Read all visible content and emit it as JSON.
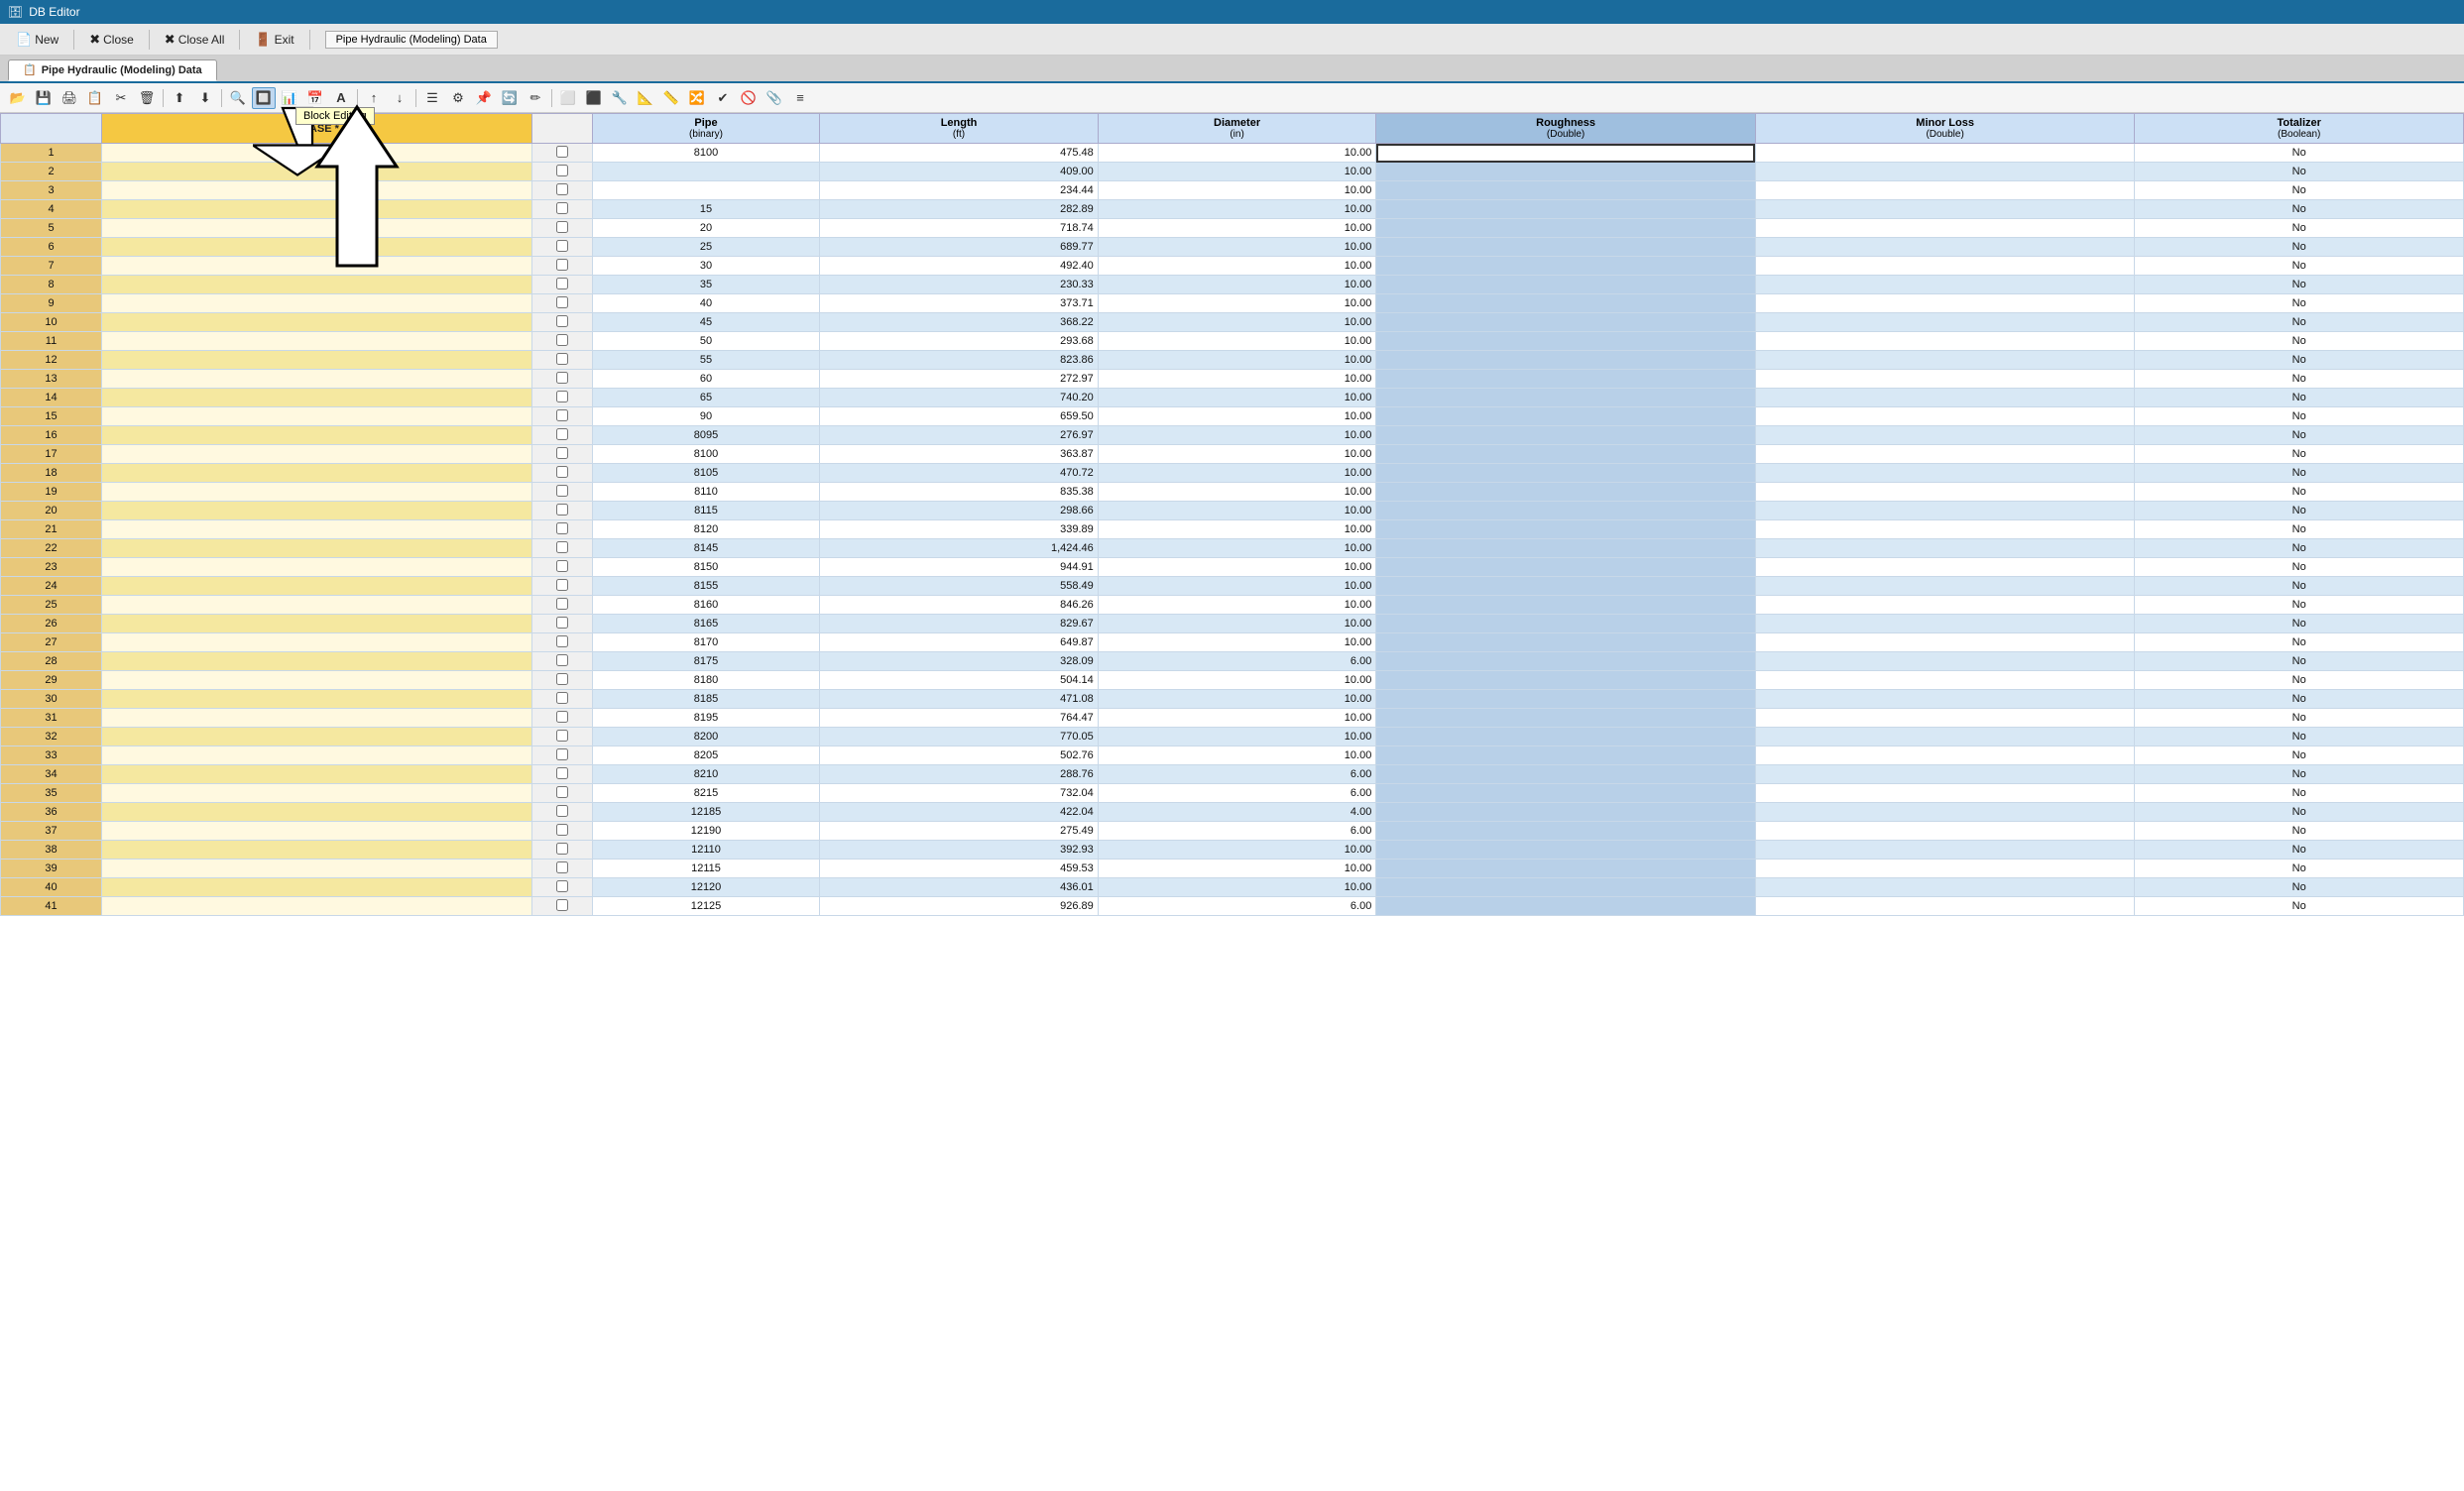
{
  "titleBar": {
    "appName": "DB Editor",
    "icon": "🗄"
  },
  "menuBar": {
    "buttons": [
      {
        "id": "new",
        "icon": "📄",
        "label": "New"
      },
      {
        "id": "close",
        "icon": "✖",
        "label": "Close"
      },
      {
        "id": "closeAll",
        "icon": "✖✖",
        "label": "Close All"
      },
      {
        "id": "exit",
        "icon": "🚪",
        "label": "Exit"
      }
    ],
    "windowTitle": "Pipe Hydraulic (Modeling) Data"
  },
  "tab": {
    "icon": "📋",
    "label": "Pipe Hydraulic (Modeling) Data"
  },
  "iconBar": {
    "icons": [
      "📂",
      "💾",
      "🖨",
      "📋",
      "✂",
      "🗑",
      "⬆",
      "⬇",
      "🔍",
      "🔎",
      "📊",
      "📅",
      "A",
      "↑",
      "↓",
      "☰",
      "⚙",
      "📌",
      "🔄",
      "✏",
      "🔲",
      "🔳",
      "⬜",
      "⬛",
      "🔧",
      "📐",
      "📏",
      "🔀",
      "✔",
      "🚫",
      "📎",
      "≡"
    ],
    "blockEditingTooltip": "Block Editing",
    "activeIconIndex": 10
  },
  "columns": [
    {
      "id": "row",
      "label": "",
      "sub": ""
    },
    {
      "id": "base",
      "label": "* BASE *",
      "sub": ""
    },
    {
      "id": "check",
      "label": "",
      "sub": ""
    },
    {
      "id": "pipe",
      "label": "Pipe",
      "sub": "(binary)"
    },
    {
      "id": "length",
      "label": "Length",
      "sub": "(ft)"
    },
    {
      "id": "diameter",
      "label": "Diameter",
      "sub": "(in)"
    },
    {
      "id": "roughness",
      "label": "Roughness",
      "sub": "(Double)"
    },
    {
      "id": "minorloss",
      "label": "Minor Loss",
      "sub": "(Double)"
    },
    {
      "id": "totalizer",
      "label": "Totalizer",
      "sub": "(Boolean)"
    }
  ],
  "rows": [
    {
      "row": 1,
      "pipe": "8100",
      "length": "475.48",
      "diameter": "10.00",
      "roughness": "",
      "minorloss": "",
      "totalizer": "No"
    },
    {
      "row": 2,
      "pipe": "",
      "length": "409.00",
      "diameter": "10.00",
      "roughness": "",
      "minorloss": "",
      "totalizer": "No"
    },
    {
      "row": 3,
      "pipe": "",
      "length": "234.44",
      "diameter": "10.00",
      "roughness": "",
      "minorloss": "",
      "totalizer": "No"
    },
    {
      "row": 4,
      "pipe": "15",
      "length": "282.89",
      "diameter": "10.00",
      "roughness": "",
      "minorloss": "",
      "totalizer": "No"
    },
    {
      "row": 5,
      "pipe": "20",
      "length": "718.74",
      "diameter": "10.00",
      "roughness": "",
      "minorloss": "",
      "totalizer": "No"
    },
    {
      "row": 6,
      "pipe": "25",
      "length": "689.77",
      "diameter": "10.00",
      "roughness": "",
      "minorloss": "",
      "totalizer": "No"
    },
    {
      "row": 7,
      "pipe": "30",
      "length": "492.40",
      "diameter": "10.00",
      "roughness": "",
      "minorloss": "",
      "totalizer": "No"
    },
    {
      "row": 8,
      "pipe": "35",
      "length": "230.33",
      "diameter": "10.00",
      "roughness": "",
      "minorloss": "",
      "totalizer": "No"
    },
    {
      "row": 9,
      "pipe": "40",
      "length": "373.71",
      "diameter": "10.00",
      "roughness": "",
      "minorloss": "",
      "totalizer": "No"
    },
    {
      "row": 10,
      "pipe": "45",
      "length": "368.22",
      "diameter": "10.00",
      "roughness": "",
      "minorloss": "",
      "totalizer": "No"
    },
    {
      "row": 11,
      "pipe": "50",
      "length": "293.68",
      "diameter": "10.00",
      "roughness": "",
      "minorloss": "",
      "totalizer": "No"
    },
    {
      "row": 12,
      "pipe": "55",
      "length": "823.86",
      "diameter": "10.00",
      "roughness": "",
      "minorloss": "",
      "totalizer": "No"
    },
    {
      "row": 13,
      "pipe": "60",
      "length": "272.97",
      "diameter": "10.00",
      "roughness": "",
      "minorloss": "",
      "totalizer": "No"
    },
    {
      "row": 14,
      "pipe": "65",
      "length": "740.20",
      "diameter": "10.00",
      "roughness": "",
      "minorloss": "",
      "totalizer": "No"
    },
    {
      "row": 15,
      "pipe": "90",
      "length": "659.50",
      "diameter": "10.00",
      "roughness": "",
      "minorloss": "",
      "totalizer": "No"
    },
    {
      "row": 16,
      "pipe": "8095",
      "length": "276.97",
      "diameter": "10.00",
      "roughness": "",
      "minorloss": "",
      "totalizer": "No"
    },
    {
      "row": 17,
      "pipe": "8100",
      "length": "363.87",
      "diameter": "10.00",
      "roughness": "",
      "minorloss": "",
      "totalizer": "No"
    },
    {
      "row": 18,
      "pipe": "8105",
      "length": "470.72",
      "diameter": "10.00",
      "roughness": "",
      "minorloss": "",
      "totalizer": "No"
    },
    {
      "row": 19,
      "pipe": "8110",
      "length": "835.38",
      "diameter": "10.00",
      "roughness": "",
      "minorloss": "",
      "totalizer": "No"
    },
    {
      "row": 20,
      "pipe": "8115",
      "length": "298.66",
      "diameter": "10.00",
      "roughness": "",
      "minorloss": "",
      "totalizer": "No"
    },
    {
      "row": 21,
      "pipe": "8120",
      "length": "339.89",
      "diameter": "10.00",
      "roughness": "",
      "minorloss": "",
      "totalizer": "No"
    },
    {
      "row": 22,
      "pipe": "8145",
      "length": "1,424.46",
      "diameter": "10.00",
      "roughness": "",
      "minorloss": "",
      "totalizer": "No"
    },
    {
      "row": 23,
      "pipe": "8150",
      "length": "944.91",
      "diameter": "10.00",
      "roughness": "",
      "minorloss": "",
      "totalizer": "No"
    },
    {
      "row": 24,
      "pipe": "8155",
      "length": "558.49",
      "diameter": "10.00",
      "roughness": "",
      "minorloss": "",
      "totalizer": "No"
    },
    {
      "row": 25,
      "pipe": "8160",
      "length": "846.26",
      "diameter": "10.00",
      "roughness": "",
      "minorloss": "",
      "totalizer": "No"
    },
    {
      "row": 26,
      "pipe": "8165",
      "length": "829.67",
      "diameter": "10.00",
      "roughness": "",
      "minorloss": "",
      "totalizer": "No"
    },
    {
      "row": 27,
      "pipe": "8170",
      "length": "649.87",
      "diameter": "10.00",
      "roughness": "",
      "minorloss": "",
      "totalizer": "No"
    },
    {
      "row": 28,
      "pipe": "8175",
      "length": "328.09",
      "diameter": "6.00",
      "roughness": "",
      "minorloss": "",
      "totalizer": "No"
    },
    {
      "row": 29,
      "pipe": "8180",
      "length": "504.14",
      "diameter": "10.00",
      "roughness": "",
      "minorloss": "",
      "totalizer": "No"
    },
    {
      "row": 30,
      "pipe": "8185",
      "length": "471.08",
      "diameter": "10.00",
      "roughness": "",
      "minorloss": "",
      "totalizer": "No"
    },
    {
      "row": 31,
      "pipe": "8195",
      "length": "764.47",
      "diameter": "10.00",
      "roughness": "",
      "minorloss": "",
      "totalizer": "No"
    },
    {
      "row": 32,
      "pipe": "8200",
      "length": "770.05",
      "diameter": "10.00",
      "roughness": "",
      "minorloss": "",
      "totalizer": "No"
    },
    {
      "row": 33,
      "pipe": "8205",
      "length": "502.76",
      "diameter": "10.00",
      "roughness": "",
      "minorloss": "",
      "totalizer": "No"
    },
    {
      "row": 34,
      "pipe": "8210",
      "length": "288.76",
      "diameter": "6.00",
      "roughness": "",
      "minorloss": "",
      "totalizer": "No"
    },
    {
      "row": 35,
      "pipe": "8215",
      "length": "732.04",
      "diameter": "6.00",
      "roughness": "",
      "minorloss": "",
      "totalizer": "No"
    },
    {
      "row": 36,
      "pipe": "12185",
      "length": "422.04",
      "diameter": "4.00",
      "roughness": "",
      "minorloss": "",
      "totalizer": "No"
    },
    {
      "row": 37,
      "pipe": "12190",
      "length": "275.49",
      "diameter": "6.00",
      "roughness": "",
      "minorloss": "",
      "totalizer": "No"
    },
    {
      "row": 38,
      "pipe": "12110",
      "length": "392.93",
      "diameter": "10.00",
      "roughness": "",
      "minorloss": "",
      "totalizer": "No"
    },
    {
      "row": 39,
      "pipe": "12115",
      "length": "459.53",
      "diameter": "10.00",
      "roughness": "",
      "minorloss": "",
      "totalizer": "No"
    },
    {
      "row": 40,
      "pipe": "12120",
      "length": "436.01",
      "diameter": "10.00",
      "roughness": "",
      "minorloss": "",
      "totalizer": "No"
    },
    {
      "row": 41,
      "pipe": "12125",
      "length": "926.89",
      "diameter": "6.00",
      "roughness": "",
      "minorloss": "",
      "totalizer": "No"
    }
  ],
  "colors": {
    "baseHeader": "#f5c842",
    "roughnessHeader": "#9fbfdf",
    "roughnessCells": "#b8d0e8",
    "rowNumBg": "#e8c87a",
    "oddRow": "#ffffff",
    "evenRow": "#d8e8f5",
    "activeCell": "#ffffff"
  }
}
